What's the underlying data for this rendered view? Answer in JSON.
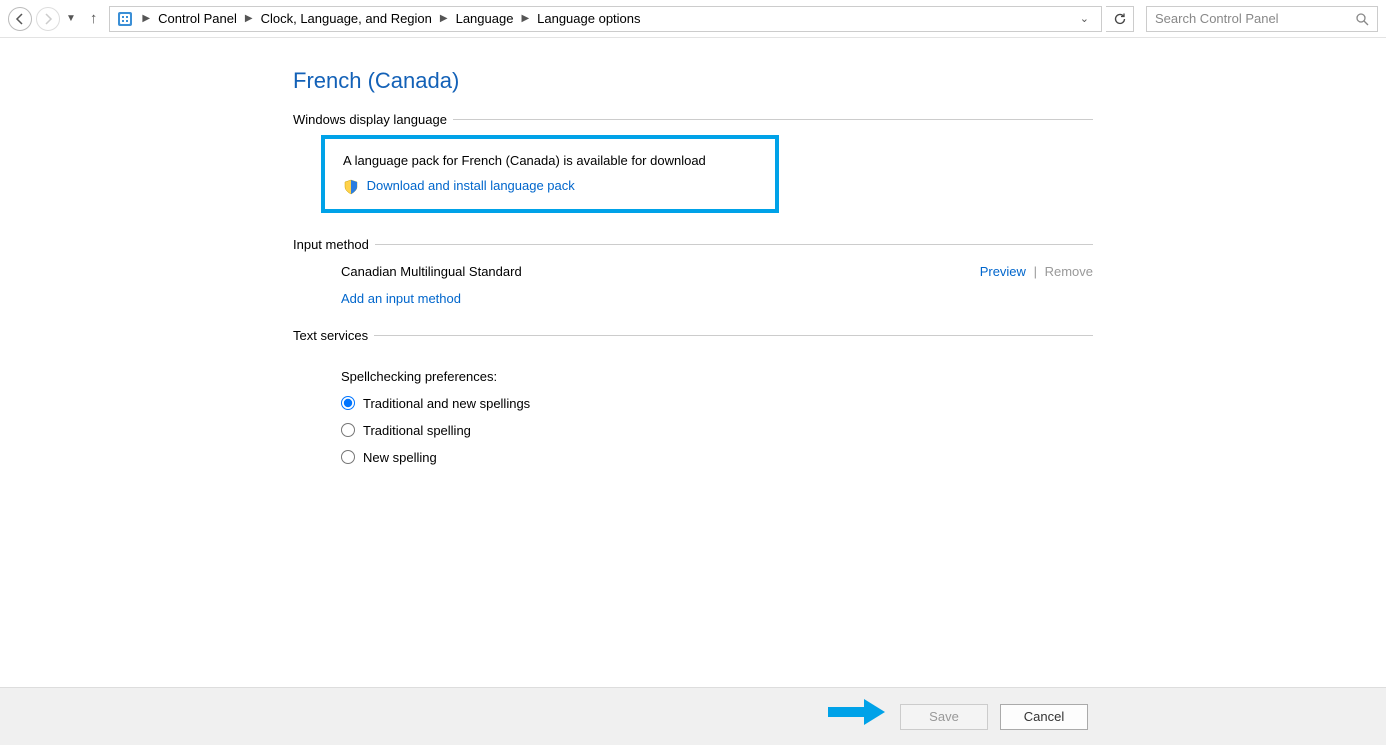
{
  "breadcrumbs": [
    "Control Panel",
    "Clock, Language, and Region",
    "Language",
    "Language options"
  ],
  "search": {
    "placeholder": "Search Control Panel"
  },
  "page": {
    "title": "French (Canada)",
    "sections": {
      "display_language": {
        "label": "Windows display language",
        "pack_msg": "A language pack for French (Canada) is available for download",
        "download_link": "Download and install language pack"
      },
      "input_method": {
        "label": "Input method",
        "method_name": "Canadian Multilingual Standard",
        "preview": "Preview",
        "remove": "Remove",
        "add_link": "Add an input method"
      },
      "text_services": {
        "label": "Text services",
        "spell_label": "Spellchecking preferences:",
        "options": [
          "Traditional and new spellings",
          "Traditional spelling",
          "New spelling"
        ],
        "selected": 0
      }
    }
  },
  "buttons": {
    "save": "Save",
    "cancel": "Cancel"
  }
}
